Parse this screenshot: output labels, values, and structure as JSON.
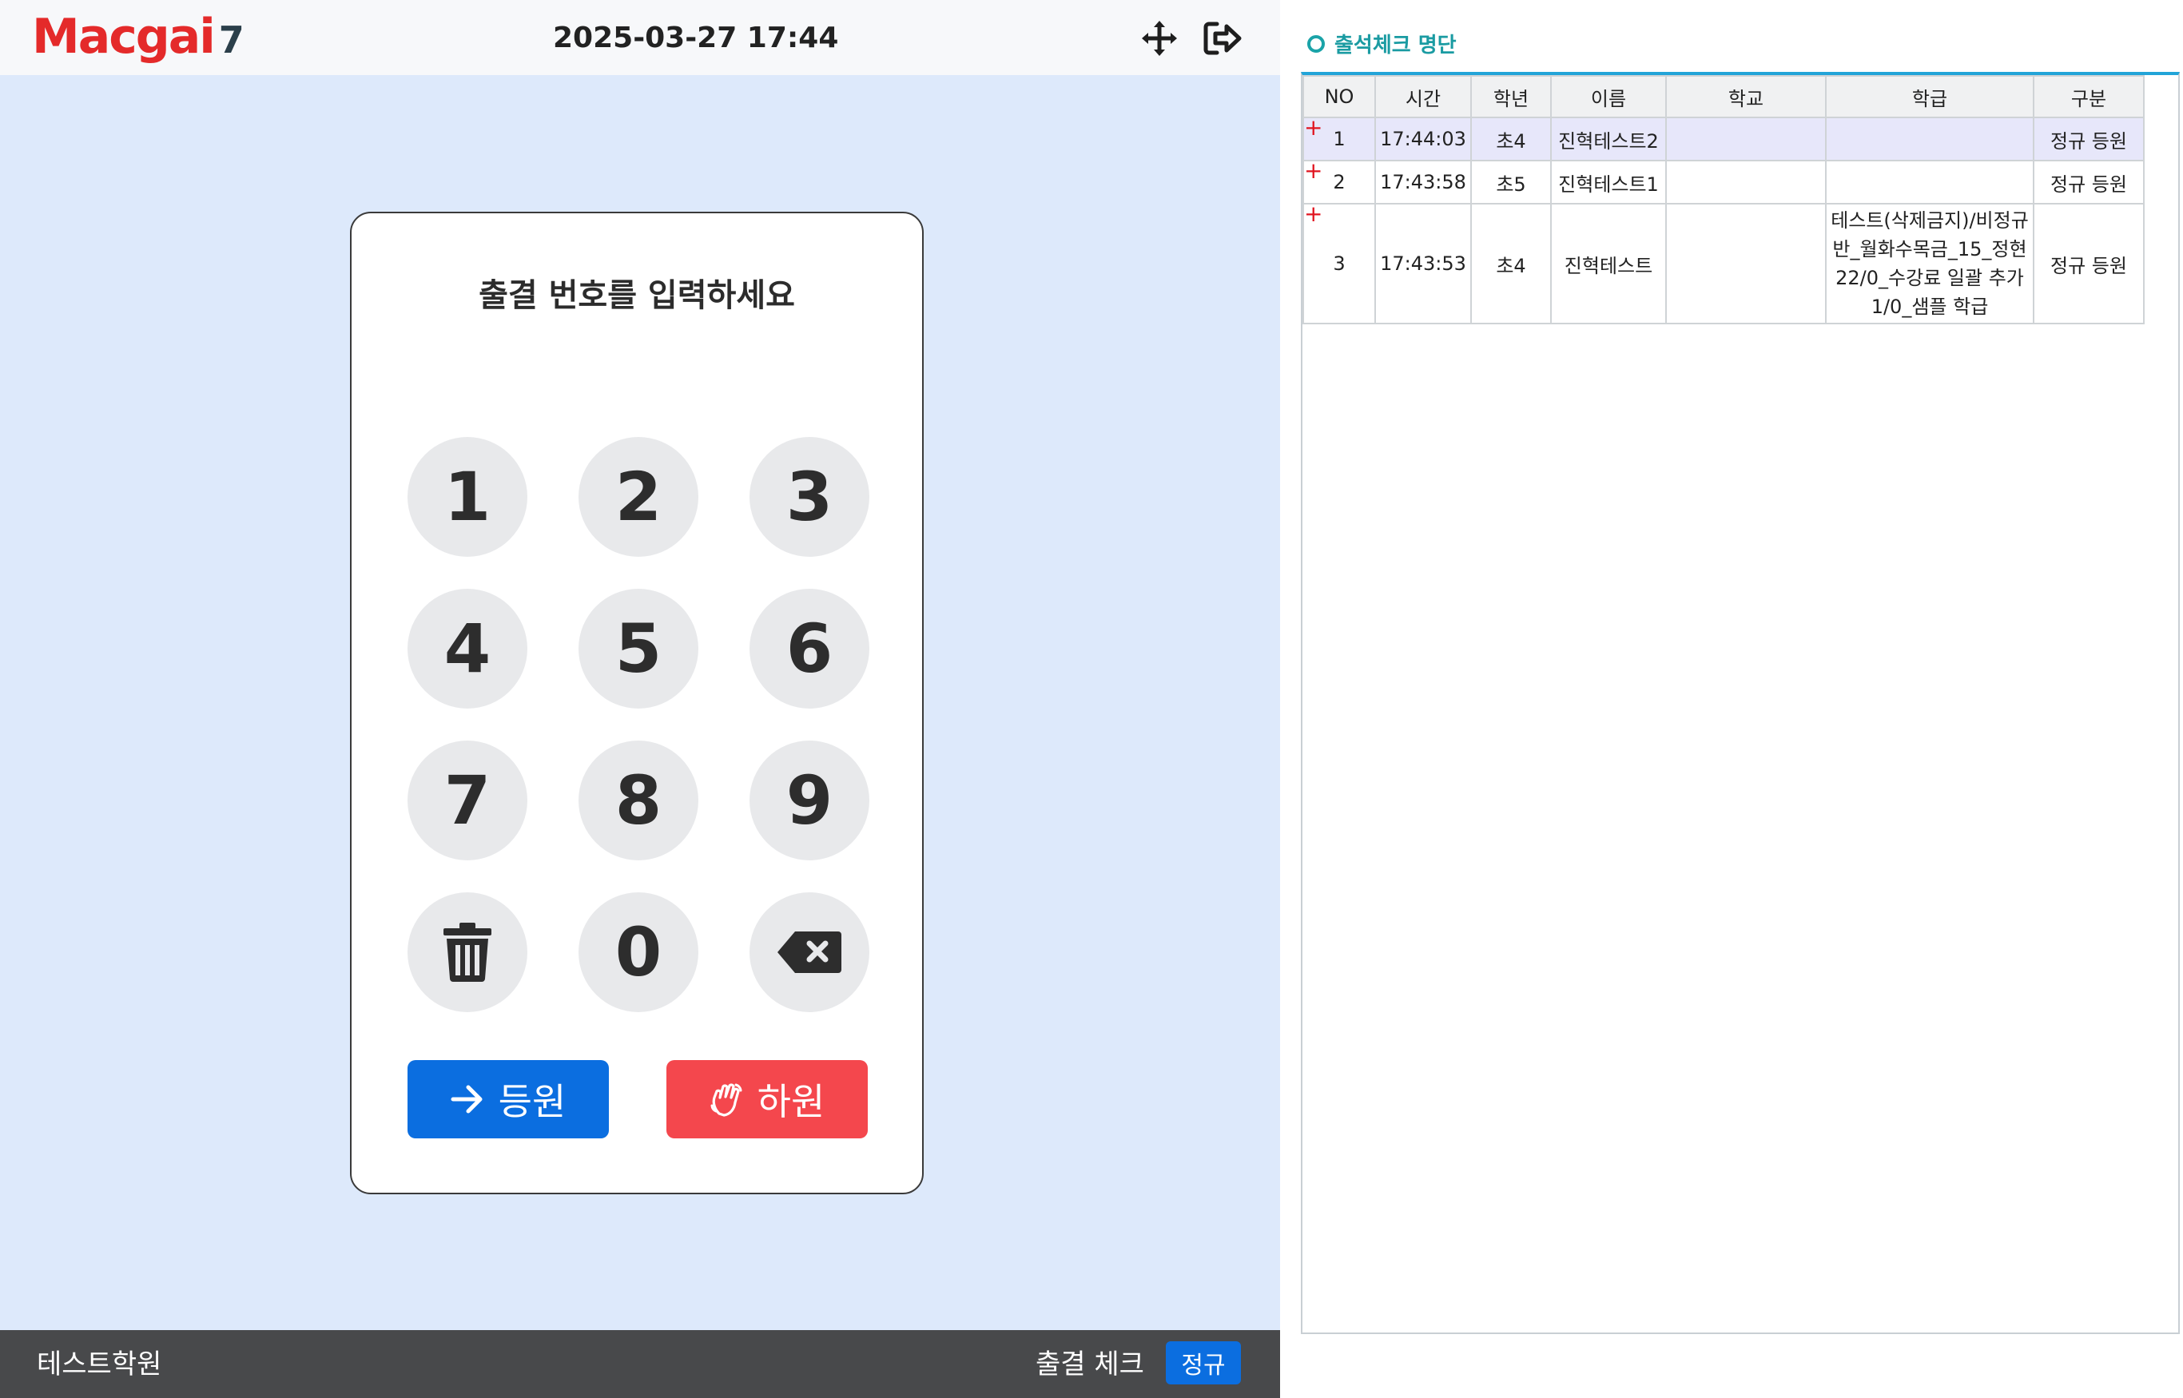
{
  "header": {
    "logo_main": "Macgai",
    "logo_num": "7",
    "datetime": "2025-03-27 17:44",
    "move_icon": "arrows-move-icon",
    "exit_icon": "sign-out-icon"
  },
  "keypad": {
    "prompt": "출결 번호를 입력하세요",
    "keys": [
      "1",
      "2",
      "3",
      "4",
      "5",
      "6",
      "7",
      "8",
      "9",
      "0"
    ],
    "clear_icon": "trash-icon",
    "backspace_icon": "backspace-icon",
    "checkin_label": "등원",
    "checkin_icon": "arrow-right-icon",
    "checkout_label": "하원",
    "checkout_icon": "waving-hand-icon"
  },
  "footer": {
    "academy_name": "테스트학원",
    "mode_label": "출결 체크",
    "mode_badge": "정규"
  },
  "attendance": {
    "title": "출석체크 명단",
    "columns": [
      "NO",
      "시간",
      "학년",
      "이름",
      "학교",
      "학급",
      "구분"
    ],
    "rows": [
      {
        "no": "1",
        "time": "17:44:03",
        "grade": "초4",
        "name": "진혁테스트2",
        "school": "",
        "class": "",
        "type": "정규 등원"
      },
      {
        "no": "2",
        "time": "17:43:58",
        "grade": "초5",
        "name": "진혁테스트1",
        "school": "",
        "class": "",
        "type": "정규 등원"
      },
      {
        "no": "3",
        "time": "17:43:53",
        "grade": "초4",
        "name": "진혁테스트",
        "school": "",
        "class": "테스트(삭제금지)/비정규반_월화수목금_15_정현22/0_수강료 일괄 추가1/0_샘플 학급",
        "type": "정규 등원"
      }
    ],
    "expand_symbol": "+"
  },
  "colors": {
    "primary": "#0b6ee0",
    "danger": "#f4474d",
    "kiosk_bg": "#dde9fb",
    "footer_bg": "#48494b",
    "logo_red": "#e42a2a",
    "teal": "#1a9ba2",
    "selected_row": "#e7e7fa"
  }
}
